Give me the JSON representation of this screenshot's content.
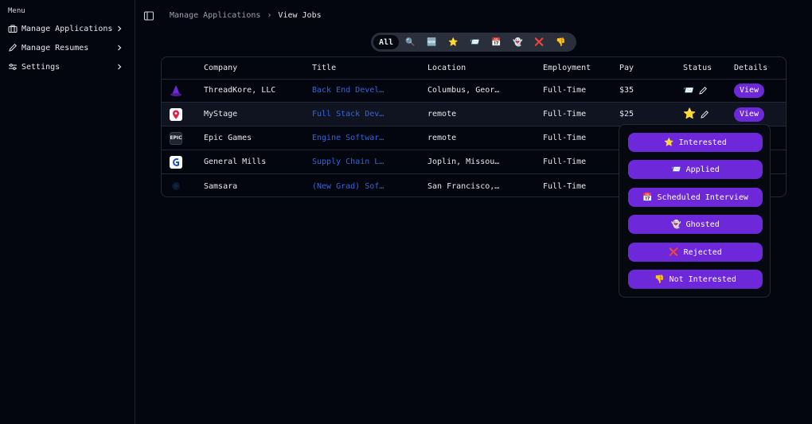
{
  "sidebar": {
    "menu_title": "Menu",
    "items": [
      {
        "label": "Manage Applications",
        "icon": "briefcase-icon"
      },
      {
        "label": "Manage Resumes",
        "icon": "pencil-icon"
      },
      {
        "label": "Settings",
        "icon": "sliders-icon"
      }
    ]
  },
  "breadcrumb": {
    "parent": "Manage Applications",
    "separator": "›",
    "current": "View Jobs"
  },
  "filters": [
    {
      "label": "All",
      "active": true
    },
    {
      "label": "🔍"
    },
    {
      "label": "🆕"
    },
    {
      "label": "⭐"
    },
    {
      "label": "📨"
    },
    {
      "label": "📅"
    },
    {
      "label": "👻"
    },
    {
      "label": "❌"
    },
    {
      "label": "👎"
    }
  ],
  "table": {
    "headers": {
      "company": "Company",
      "title": "Title",
      "location": "Location",
      "employment": "Employment",
      "pay": "Pay",
      "status": "Status",
      "details": "Details"
    },
    "rows": [
      {
        "company": "ThreadKore, LLC",
        "title": "Back End Devel…",
        "location": "Columbus, Geor…",
        "employment": "Full-Time",
        "pay": "$35",
        "status_emoji": "📨",
        "view": "View",
        "logo": "wizard-hat-logo"
      },
      {
        "company": "MyStage",
        "title": "Full Stack Dev…",
        "location": "remote",
        "employment": "Full-Time",
        "pay": "$25",
        "status_emoji": "⭐",
        "view": "View",
        "logo": "mystage-logo"
      },
      {
        "company": "Epic Games",
        "title": "Engine Softwar…",
        "location": "remote",
        "employment": "Full-Time",
        "pay": "",
        "status_emoji": "",
        "view": "",
        "logo": "epic-games-logo"
      },
      {
        "company": "General Mills",
        "title": "Supply Chain L…",
        "location": "Joplin, Missou…",
        "employment": "Full-Time",
        "pay": "",
        "status_emoji": "",
        "view": "",
        "logo": "general-mills-logo"
      },
      {
        "company": "Samsara",
        "title": "(New Grad) Sof…",
        "location": "San Francisco,…",
        "employment": "Full-Time",
        "pay": "",
        "status_emoji": "",
        "view": "",
        "logo": "samsara-logo"
      }
    ]
  },
  "status_menu": [
    {
      "emoji": "⭐",
      "label": "Interested"
    },
    {
      "emoji": "📨",
      "label": "Applied"
    },
    {
      "emoji": "📅",
      "label": "Scheduled Interview"
    },
    {
      "emoji": "👻",
      "label": "Ghosted"
    },
    {
      "emoji": "❌",
      "label": "Rejected"
    },
    {
      "emoji": "👎",
      "label": "Not Interested"
    }
  ],
  "colors": {
    "accent": "#6d28d9",
    "title_link": "#2f66e0",
    "background": "#03060f"
  }
}
